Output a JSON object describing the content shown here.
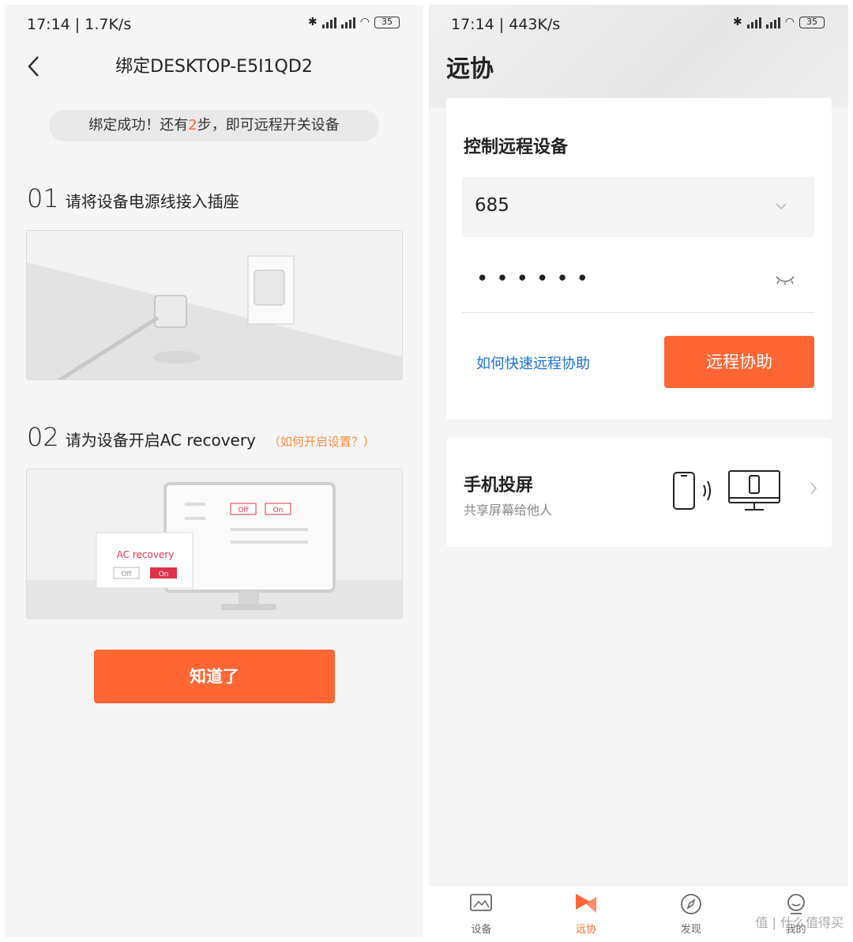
{
  "left": {
    "status": {
      "time": "17:14 | 1.7K/s",
      "battery": "35"
    },
    "title": "绑定DESKTOP-E5I1QD2",
    "notice": {
      "pre": "绑定成功！还有",
      "highlight": "2",
      "post": "步，即可远程开关设备"
    },
    "step1": {
      "num": "01",
      "text": "请将设备电源线接入插座"
    },
    "step2": {
      "num": "02",
      "text": "请为设备开启AC recovery",
      "link": "（如何开启设置？）"
    },
    "illus2": {
      "off": "Off",
      "on": "On",
      "label": "AC recovery"
    },
    "confirm_label": "知道了"
  },
  "right": {
    "status": {
      "time": "17:14 | 443K/s",
      "battery": "35"
    },
    "title": "远协",
    "control": {
      "heading": "控制远程设备",
      "device_id": "685",
      "password_mask": "••••••",
      "help_link": "如何快速远程协助",
      "remote_button": "远程协助"
    },
    "cast": {
      "title": "手机投屏",
      "subtitle": "共享屏幕给他人"
    },
    "tabs": [
      {
        "label": "设备",
        "icon": "device-icon",
        "active": false
      },
      {
        "label": "远协",
        "icon": "remote-icon",
        "active": true
      },
      {
        "label": "发现",
        "icon": "compass-icon",
        "active": false
      },
      {
        "label": "我的",
        "icon": "profile-icon",
        "active": false
      }
    ],
    "watermark": "值 | 什么值得买"
  },
  "colors": {
    "accent": "#ff6633",
    "link": "#1a6fd6",
    "background": "#f5f5f5"
  }
}
